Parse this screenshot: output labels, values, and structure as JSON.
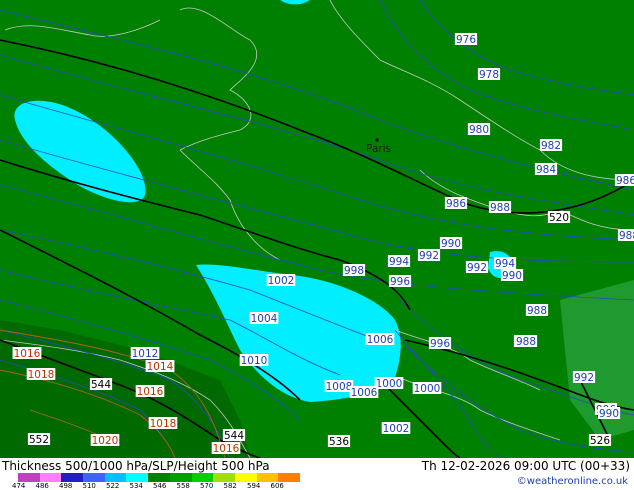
{
  "map": {
    "city_label": "Paris",
    "colors": {
      "land_green": "#008000",
      "dark_green": "#006400",
      "light_green": "#22a032",
      "cyan": "#00eeff",
      "light_cyan": "#66ffff",
      "isobar_blue": "#2040c0",
      "label_box": "#ffffff"
    },
    "isobar_labels": [
      "976",
      "978",
      "980",
      "982",
      "984",
      "986",
      "988",
      "990",
      "992",
      "994",
      "996",
      "998",
      "1000",
      "1002",
      "1004",
      "1006",
      "1008",
      "1010",
      "1012",
      "1014",
      "1016",
      "1018",
      "1020",
      "986",
      "988",
      "992",
      "994",
      "998",
      "990",
      "988",
      "998",
      "992",
      "996",
      "996",
      "1006",
      "1000",
      "1002",
      "988",
      "990",
      "988",
      "1016",
      "1014",
      "1016",
      "1018",
      "520",
      "526",
      "544",
      "544",
      "552",
      "536",
      "1016"
    ],
    "thickness_labels": [
      "520",
      "526",
      "544",
      "552",
      "536"
    ]
  },
  "footer": {
    "title": "Thickness 500/1000 hPa/SLP/Height 500 hPa",
    "datetime": "Th 12-02-2026 09:00 UTC (00+33)",
    "credit": "©weatheronline.co.uk",
    "legend_colors": [
      "#c040c0",
      "#ff80ff",
      "#2020c0",
      "#4060ff",
      "#00c0ff",
      "#00ffff",
      "#008000",
      "#00a000",
      "#00d000",
      "#a0e000",
      "#ffff00",
      "#ffc000",
      "#ff8000"
    ],
    "legend_ticks": [
      "474",
      "486",
      "498",
      "510",
      "522",
      "534",
      "546",
      "558",
      "570",
      "582",
      "594",
      "606"
    ]
  }
}
